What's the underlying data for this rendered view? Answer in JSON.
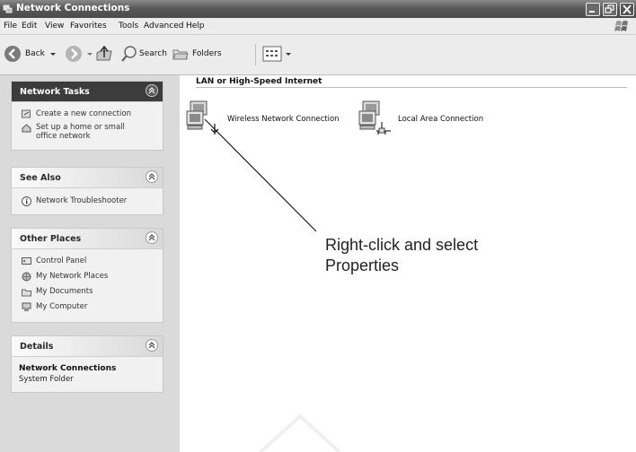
{
  "window": {
    "title": "Network Connections"
  },
  "menu": [
    "File",
    "Edit",
    "View",
    "Favorites",
    "Tools",
    "Advanced",
    "Help"
  ],
  "toolbar": {
    "back": "Back",
    "search": "Search",
    "folders": "Folders"
  },
  "sidebar": {
    "network_tasks": {
      "title": "Network Tasks",
      "items": [
        "Create a new connection",
        "Set up a home or small office network"
      ]
    },
    "see_also": {
      "title": "See Also",
      "items": [
        "Network Troubleshooter"
      ]
    },
    "other_places": {
      "title": "Other Places",
      "items": [
        "Control Panel",
        "My Network Places",
        "My Documents",
        "My Computer"
      ]
    },
    "details": {
      "title": "Details",
      "name": "Network Connections",
      "type": "System Folder"
    }
  },
  "main": {
    "group_header": "LAN or High-Speed Internet",
    "connections": [
      "Wireless Network Connection",
      "Local Area Connection"
    ]
  },
  "callout": "Right-click and select\nProperties"
}
